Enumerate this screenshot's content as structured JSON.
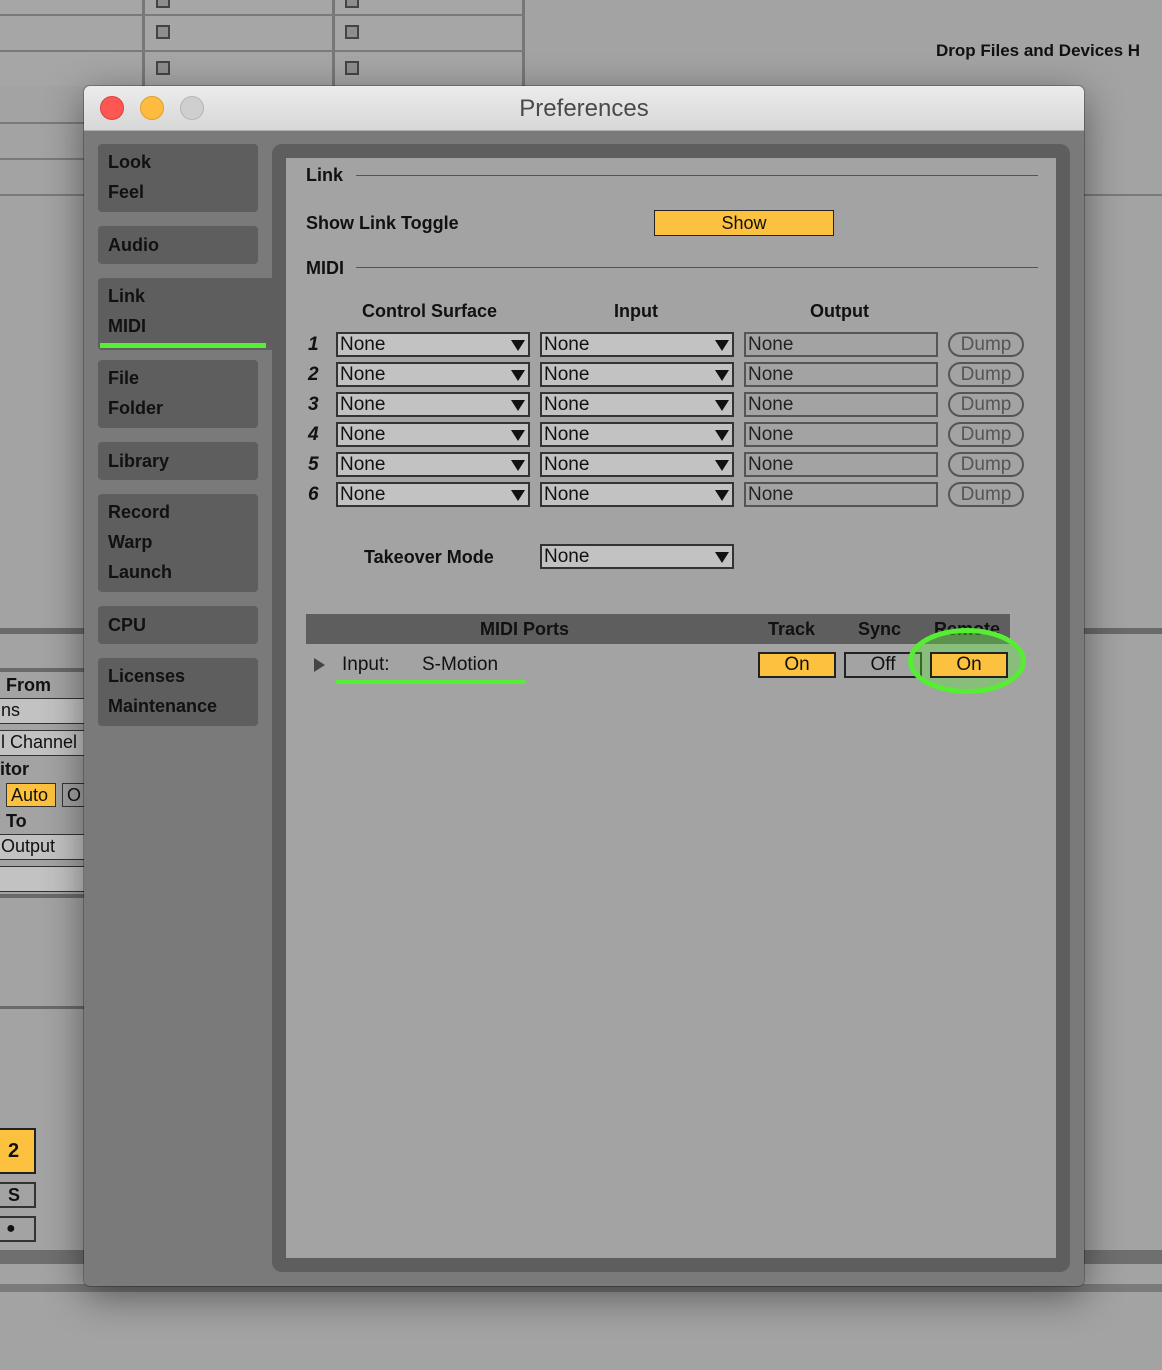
{
  "background": {
    "drop_hint": "Drop Files and Devices H",
    "left_panel": {
      "from": "From",
      "ns": "ns",
      "channel": "l Channel",
      "monitor": "itor",
      "auto": "Auto",
      "o": "O",
      "to": "To",
      "output": "Output",
      "track_number": "2",
      "solo": "S",
      "record": "●"
    }
  },
  "window": {
    "title": "Preferences"
  },
  "sidebar": {
    "groups": [
      {
        "labels": [
          "Look",
          "Feel"
        ]
      },
      {
        "labels": [
          "Audio"
        ]
      },
      {
        "labels": [
          "Link",
          "MIDI"
        ]
      },
      {
        "labels": [
          "File",
          "Folder"
        ]
      },
      {
        "labels": [
          "Library"
        ]
      },
      {
        "labels": [
          "Record",
          "Warp",
          "Launch"
        ]
      },
      {
        "labels": [
          "CPU"
        ]
      },
      {
        "labels": [
          "Licenses",
          "Maintenance"
        ]
      }
    ],
    "active_group": "Link MIDI"
  },
  "link": {
    "section_title": "Link",
    "show_toggle_label": "Show Link Toggle",
    "show_toggle_value": "Show"
  },
  "midi": {
    "section_title": "MIDI",
    "columns": {
      "control_surface": "Control Surface",
      "input": "Input",
      "output": "Output"
    },
    "rows": [
      {
        "num": "1",
        "control_surface": "None",
        "input": "None",
        "output": "None",
        "dump": "Dump"
      },
      {
        "num": "2",
        "control_surface": "None",
        "input": "None",
        "output": "None",
        "dump": "Dump"
      },
      {
        "num": "3",
        "control_surface": "None",
        "input": "None",
        "output": "None",
        "dump": "Dump"
      },
      {
        "num": "4",
        "control_surface": "None",
        "input": "None",
        "output": "None",
        "dump": "Dump"
      },
      {
        "num": "5",
        "control_surface": "None",
        "input": "None",
        "output": "None",
        "dump": "Dump"
      },
      {
        "num": "6",
        "control_surface": "None",
        "input": "None",
        "output": "None",
        "dump": "Dump"
      }
    ],
    "takeover_label": "Takeover Mode",
    "takeover_value": "None"
  },
  "midi_ports": {
    "header": {
      "ports": "MIDI Ports",
      "track": "Track",
      "sync": "Sync",
      "remote": "Remote"
    },
    "rows": [
      {
        "direction": "Input:",
        "name": "S-Motion",
        "track": "On",
        "sync": "Off",
        "remote": "On"
      }
    ]
  },
  "colors": {
    "accent_yellow": "#fcc23f",
    "highlight_green": "#55ee33",
    "panel_gray": "#a3a3a3",
    "sidebar_gray": "#5e5e5e"
  }
}
